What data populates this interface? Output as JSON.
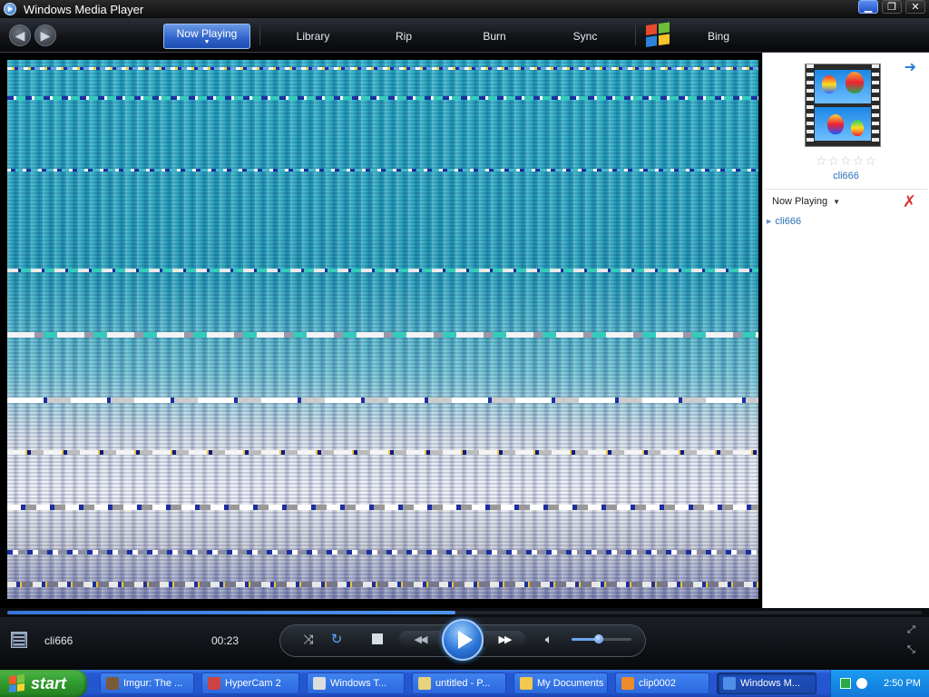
{
  "window": {
    "title": "Windows Media Player",
    "buttons": {
      "minimize": "▁",
      "restore": "❐",
      "close": "✕"
    }
  },
  "nav": {
    "back_icon": "back-arrow-icon",
    "forward_icon": "forward-arrow-icon",
    "tabs": [
      {
        "label": "Now Playing",
        "active": true
      },
      {
        "label": "Library"
      },
      {
        "label": "Rip"
      },
      {
        "label": "Burn"
      },
      {
        "label": "Sync"
      },
      {
        "label": "Bing"
      }
    ],
    "active_caret": "▼"
  },
  "panel": {
    "track_title": "cli666",
    "rating_stars": 5,
    "now_playing_label": "Now Playing",
    "playlist": [
      {
        "title": "cli666"
      }
    ]
  },
  "player": {
    "track_title": "cli666",
    "elapsed": "00:23",
    "seek_progress": 0.49,
    "volume_level": 0.45
  },
  "taskbar": {
    "start_label": "start",
    "tasks": [
      {
        "label": "Imgur: The ...",
        "icon_color": "#7b5a3a"
      },
      {
        "label": "HyperCam 2",
        "icon_color": "#c44"
      },
      {
        "label": "Windows T...",
        "icon_color": "#ddd"
      },
      {
        "label": "untitled - P...",
        "icon_color": "#e8d27a"
      },
      {
        "label": "My Documents",
        "icon_color": "#f2c94c"
      },
      {
        "label": "clip0002",
        "icon_color": "#f08a2a"
      },
      {
        "label": "Windows M...",
        "icon_color": "#4d8fe6",
        "active": true
      }
    ],
    "clock": "2:50 PM"
  }
}
